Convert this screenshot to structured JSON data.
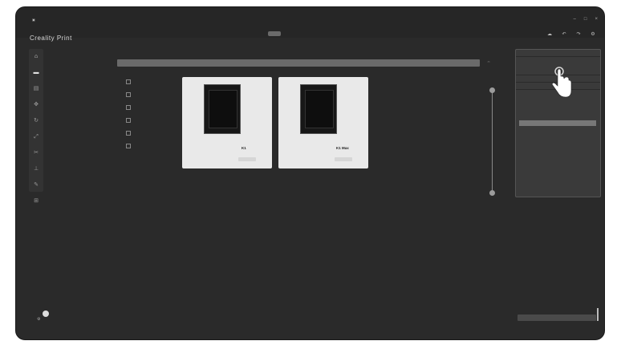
{
  "window": {
    "app_title": "Creality Print",
    "menu": [
      "",
      "",
      "",
      "",
      "",
      ""
    ],
    "tabs": [
      {
        "label": "",
        "active": true
      },
      {
        "label": "",
        "active": false
      },
      {
        "label": "",
        "active": false
      }
    ],
    "controls": [
      "–",
      "□",
      "×"
    ]
  },
  "toolbar_icons": [
    "home-icon",
    "printer-icon",
    "layers-icon",
    "move-icon",
    "rotate-icon",
    "scale-icon",
    "cut-icon",
    "support-icon",
    "paint-icon",
    "measure-icon"
  ],
  "bed_bar": {
    "label": ""
  },
  "filters": [
    "",
    "",
    "",
    "",
    "",
    ""
  ],
  "printers": [
    {
      "model": "K1",
      "specs": [
        "",
        "",
        ""
      ]
    },
    {
      "model": "K1 Max",
      "specs": [
        "",
        "",
        ""
      ]
    }
  ],
  "right_panel": {
    "sections": [
      "",
      "",
      "",
      ""
    ],
    "rows": [
      "",
      ""
    ]
  },
  "colors": {
    "background": "#2a2a2a",
    "panel": "#3a3a3a",
    "card": "#e9e9e9",
    "active_tab": "#6a6a6a"
  }
}
